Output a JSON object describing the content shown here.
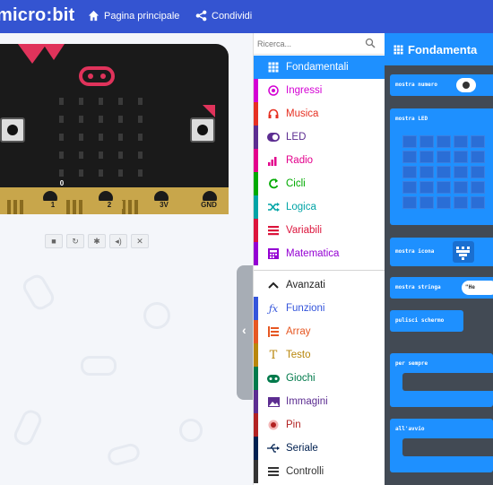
{
  "app": {
    "brand": "micro:bit",
    "nav": [
      {
        "label": "Pagina principale",
        "icon": "home-icon"
      },
      {
        "label": "Condividi",
        "icon": "share-icon"
      }
    ]
  },
  "simulator": {
    "pins": [
      "0",
      "1",
      "2",
      "3V",
      "GND"
    ],
    "controls": [
      "stop-icon",
      "restart-icon",
      "slow-motion-icon",
      "mute-icon",
      "fullscreen-icon"
    ]
  },
  "toolbox": {
    "search_placeholder": "Ricerca...",
    "categories": [
      {
        "label": "Fondamentali",
        "color": "#1e90ff",
        "icon": "grid-icon",
        "selected": true
      },
      {
        "label": "Ingressi",
        "color": "#d400d4",
        "icon": "target-icon"
      },
      {
        "label": "Musica",
        "color": "#e63022",
        "icon": "headphones-icon"
      },
      {
        "label": "LED",
        "color": "#5c2d91",
        "icon": "toggle-icon"
      },
      {
        "label": "Radio",
        "color": "#e3008c",
        "icon": "signal-bars-icon"
      },
      {
        "label": "Cicli",
        "color": "#00aa00",
        "icon": "loop-arrow-icon"
      },
      {
        "label": "Logica",
        "color": "#00a4a6",
        "icon": "shuffle-icon"
      },
      {
        "label": "Variabili",
        "color": "#dc143c",
        "icon": "list-lines-icon"
      },
      {
        "label": "Matematica",
        "color": "#9400d3",
        "icon": "calculator-icon"
      }
    ],
    "advanced": [
      {
        "label": "Avanzati",
        "color": "#3c3c3c",
        "icon": "chevron-up-icon"
      },
      {
        "label": "Funzioni",
        "color": "#3455db",
        "icon": "function-icon"
      },
      {
        "label": "Array",
        "color": "#e65722",
        "icon": "array-lines-icon"
      },
      {
        "label": "Testo",
        "color": "#b8860b",
        "icon": "text-t-icon"
      },
      {
        "label": "Giochi",
        "color": "#007a4b",
        "icon": "gamepad-icon"
      },
      {
        "label": "Immagini",
        "color": "#5c2d91",
        "icon": "image-icon"
      },
      {
        "label": "Pin",
        "color": "#b22222",
        "icon": "pin-dot-icon"
      },
      {
        "label": "Seriale",
        "color": "#002050",
        "icon": "usb-icon"
      },
      {
        "label": "Controlli",
        "color": "#333333",
        "icon": "controls-icon"
      }
    ]
  },
  "flyout": {
    "title": "Fondamenta",
    "blocks": [
      {
        "label": "mostra numero"
      },
      {
        "label": "mostra LED"
      },
      {
        "label": "mostra icona"
      },
      {
        "label": "mostra stringa",
        "value": "\"He"
      },
      {
        "label": "pulisci schermo"
      },
      {
        "label": "per sempre"
      },
      {
        "label": "all'avvio"
      }
    ]
  }
}
